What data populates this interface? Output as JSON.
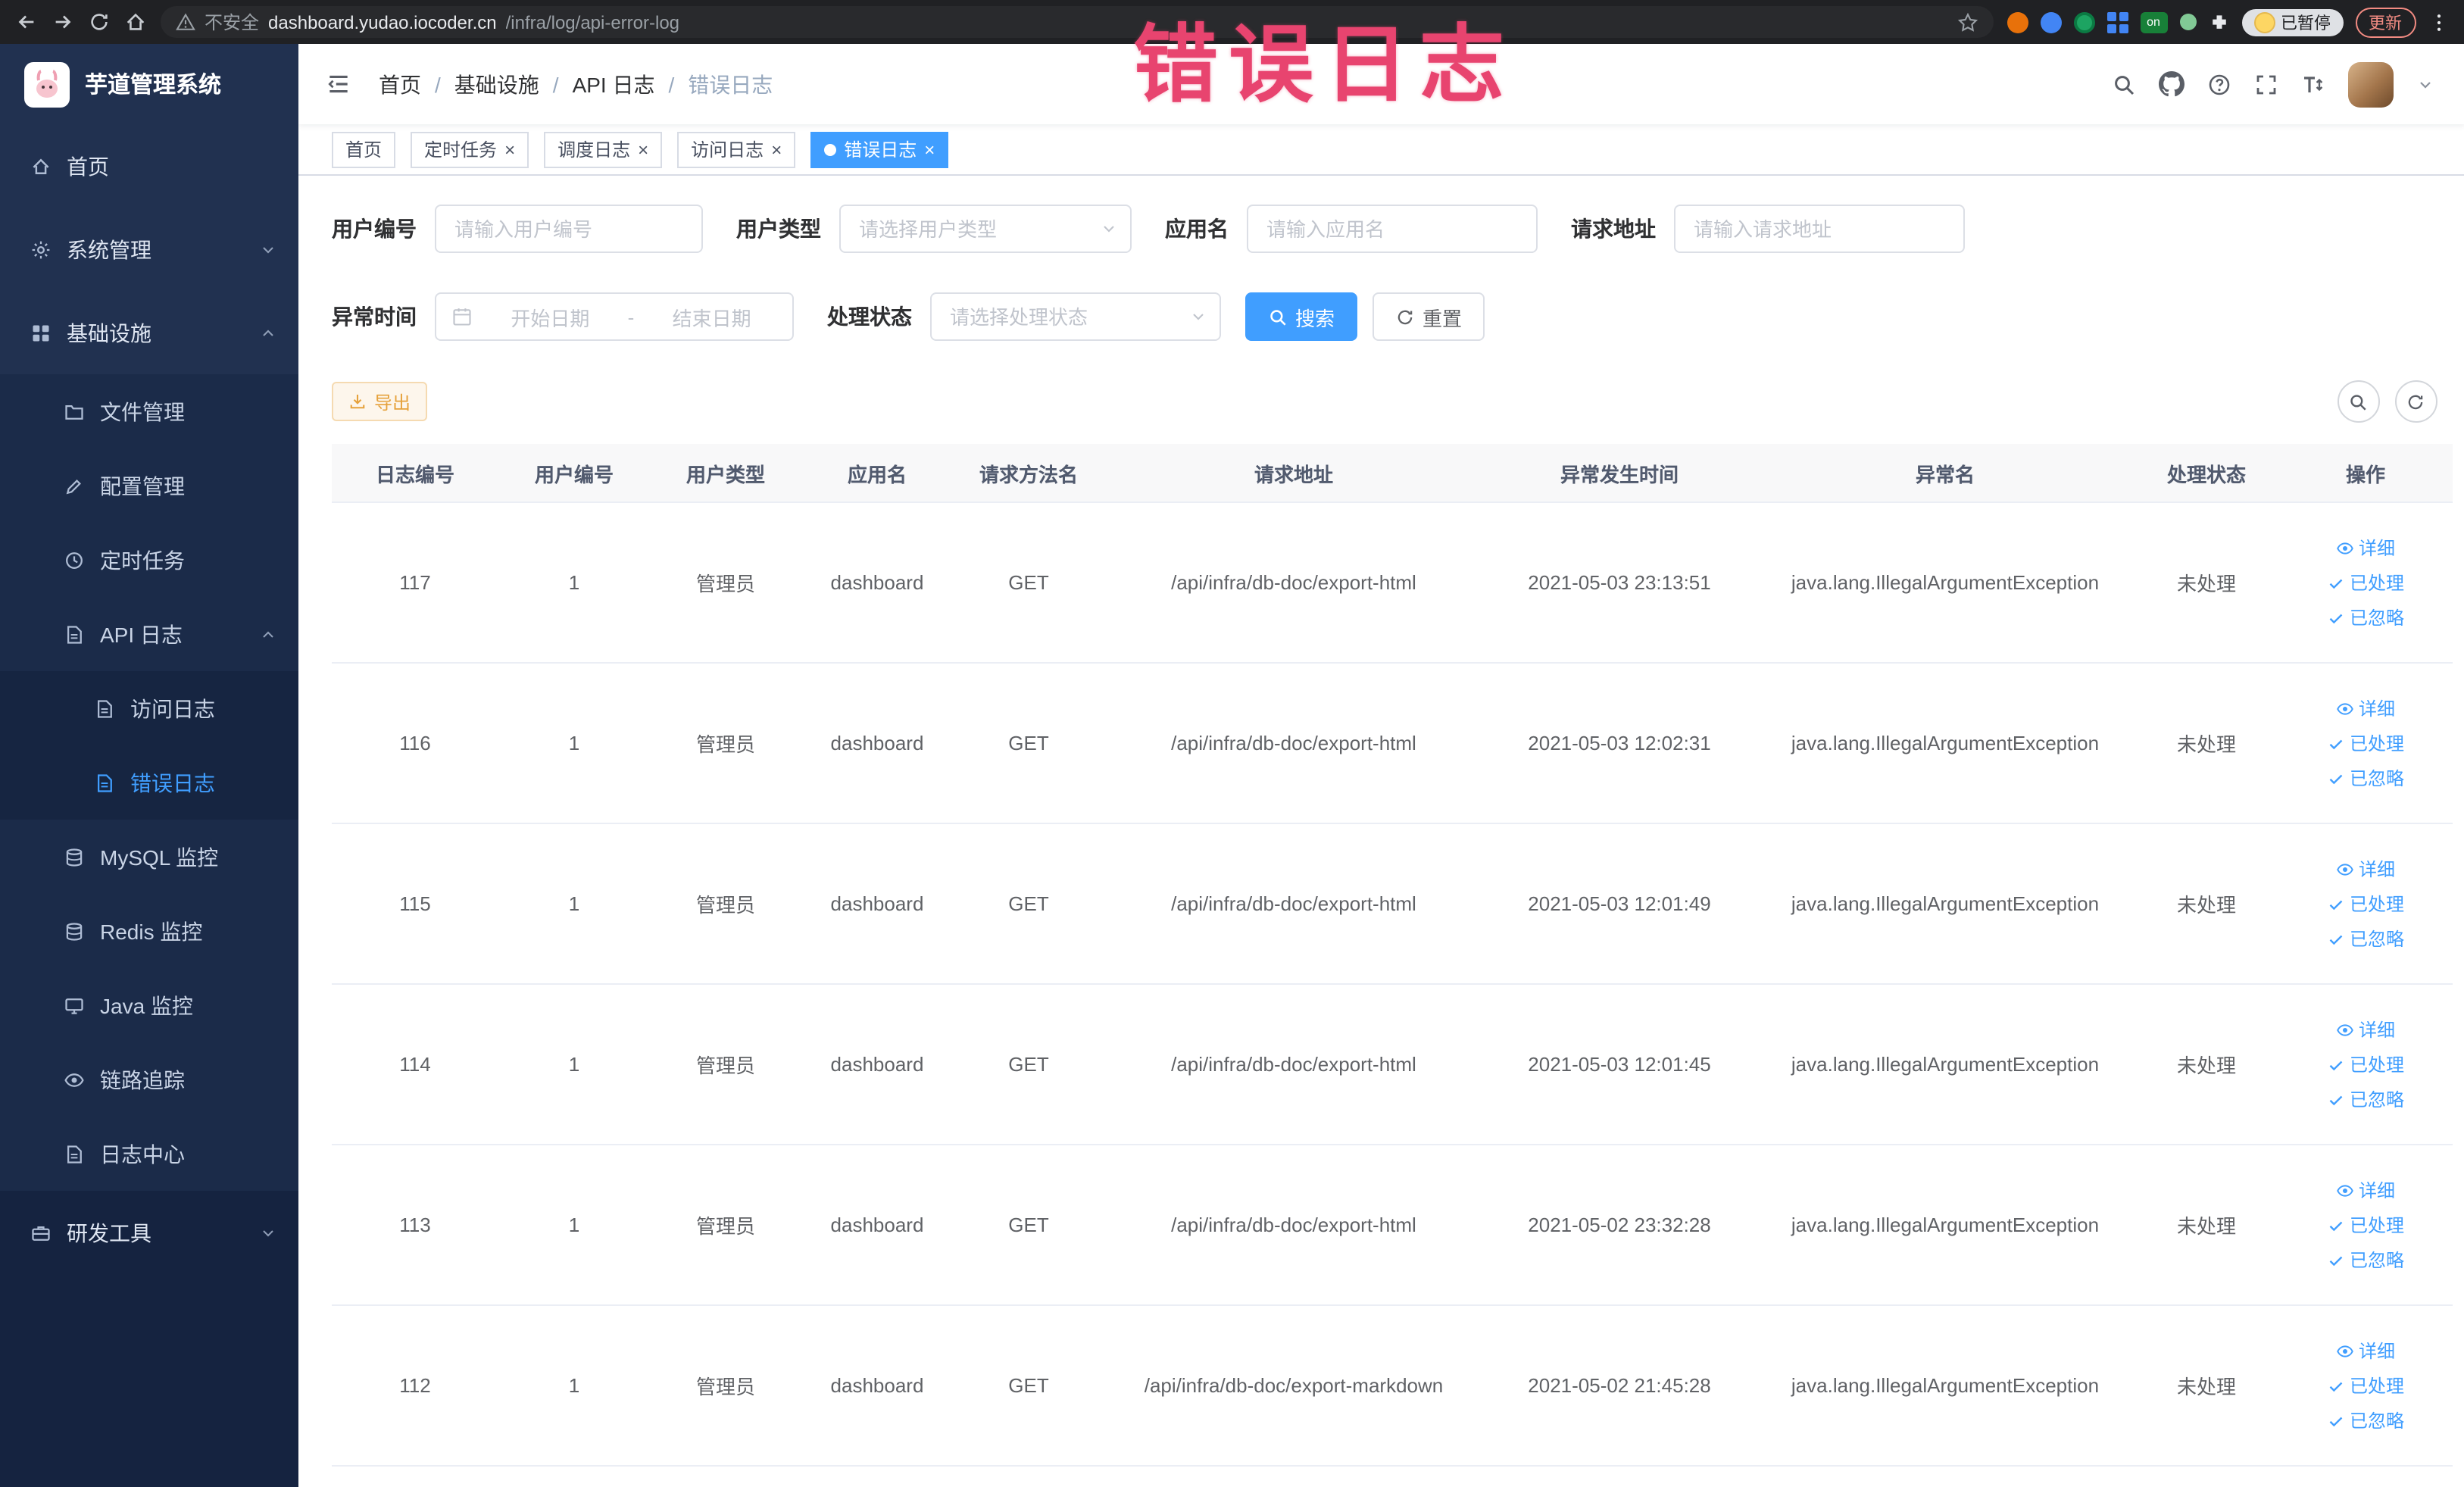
{
  "annotation": {
    "text": "错误日志",
    "color": "#e8446f"
  },
  "browser": {
    "security_label": "不安全",
    "url_host": "dashboard.yudao.iocoder.cn",
    "url_path": "/infra/log/api-error-log",
    "paused_chip": "已暂停",
    "update_chip": "更新",
    "extension_badge_on": "on"
  },
  "ui": {
    "close": "×",
    "crumb_sep": "/"
  },
  "sidebar": {
    "logo_title": "芋道管理系统",
    "items": [
      {
        "name": "home",
        "label": "首页",
        "icon": "home",
        "level": 1
      },
      {
        "name": "system-mgmt",
        "label": "系统管理",
        "icon": "gear",
        "level": 1,
        "arrow": "down"
      },
      {
        "name": "infrastructure",
        "label": "基础设施",
        "icon": "grid",
        "level": 1,
        "arrow": "up"
      },
      {
        "name": "file-mgmt",
        "label": "文件管理",
        "icon": "folder",
        "level": 2
      },
      {
        "name": "config-mgmt",
        "label": "配置管理",
        "icon": "edit",
        "level": 2
      },
      {
        "name": "scheduled-tasks",
        "label": "定时任务",
        "icon": "clock",
        "level": 2
      },
      {
        "name": "api-log",
        "label": "API 日志",
        "icon": "doc",
        "level": 2,
        "arrow": "up"
      },
      {
        "name": "access-log",
        "label": "访问日志",
        "icon": "doc",
        "level": 3
      },
      {
        "name": "error-log",
        "label": "错误日志",
        "icon": "doc",
        "level": 3,
        "active": true
      },
      {
        "name": "mysql-monitor",
        "label": "MySQL 监控",
        "icon": "db",
        "level": 2
      },
      {
        "name": "redis-monitor",
        "label": "Redis 监控",
        "icon": "db",
        "level": 2
      },
      {
        "name": "java-monitor",
        "label": "Java 监控",
        "icon": "monitor",
        "level": 2
      },
      {
        "name": "tracing",
        "label": "链路追踪",
        "icon": "eye",
        "level": 2
      },
      {
        "name": "log-center",
        "label": "日志中心",
        "icon": "doc",
        "level": 2
      },
      {
        "name": "dev-tools",
        "label": "研发工具",
        "icon": "tools",
        "level": 1,
        "arrow": "down",
        "dark": true
      }
    ]
  },
  "header": {
    "breadcrumbs": [
      "首页",
      "基础设施",
      "API 日志",
      "错误日志"
    ]
  },
  "tabs": [
    {
      "name": "home",
      "label": "首页",
      "closable": false,
      "active": false
    },
    {
      "name": "scheduled-tasks",
      "label": "定时任务",
      "closable": true,
      "active": false
    },
    {
      "name": "schedule-log",
      "label": "调度日志",
      "closable": true,
      "active": false
    },
    {
      "name": "access-log",
      "label": "访问日志",
      "closable": true,
      "active": false
    },
    {
      "name": "error-log",
      "label": "错误日志",
      "closable": true,
      "active": true
    }
  ],
  "filters": {
    "user_id": {
      "label": "用户编号",
      "placeholder": "请输入用户编号"
    },
    "user_type": {
      "label": "用户类型",
      "placeholder": "请选择用户类型"
    },
    "app_name": {
      "label": "应用名",
      "placeholder": "请输入应用名"
    },
    "request_url": {
      "label": "请求地址",
      "placeholder": "请输入请求地址"
    },
    "exception_time": {
      "label": "异常时间",
      "start": "开始日期",
      "separator": "-",
      "end": "结束日期"
    },
    "process_status": {
      "label": "处理状态",
      "placeholder": "请选择处理状态"
    },
    "search_label": "搜索",
    "reset_label": "重置"
  },
  "toolbar": {
    "export_label": "导出"
  },
  "table": {
    "columns": [
      "日志编号",
      "用户编号",
      "用户类型",
      "应用名",
      "请求方法名",
      "请求地址",
      "异常发生时间",
      "异常名",
      "处理状态",
      "操作"
    ],
    "actions": {
      "detail": "详细",
      "processed": "已处理",
      "ignored": "已忽略"
    },
    "rows": [
      {
        "id": "117",
        "user_id": "1",
        "user_type": "管理员",
        "app": "dashboard",
        "method": "GET",
        "url": "/api/infra/db-doc/export-html",
        "time": "2021-05-03 23:13:51",
        "exception": "java.lang.IllegalArgumentException",
        "status": "未处理"
      },
      {
        "id": "116",
        "user_id": "1",
        "user_type": "管理员",
        "app": "dashboard",
        "method": "GET",
        "url": "/api/infra/db-doc/export-html",
        "time": "2021-05-03 12:02:31",
        "exception": "java.lang.IllegalArgumentException",
        "status": "未处理"
      },
      {
        "id": "115",
        "user_id": "1",
        "user_type": "管理员",
        "app": "dashboard",
        "method": "GET",
        "url": "/api/infra/db-doc/export-html",
        "time": "2021-05-03 12:01:49",
        "exception": "java.lang.IllegalArgumentException",
        "status": "未处理"
      },
      {
        "id": "114",
        "user_id": "1",
        "user_type": "管理员",
        "app": "dashboard",
        "method": "GET",
        "url": "/api/infra/db-doc/export-html",
        "time": "2021-05-03 12:01:45",
        "exception": "java.lang.IllegalArgumentException",
        "status": "未处理"
      },
      {
        "id": "113",
        "user_id": "1",
        "user_type": "管理员",
        "app": "dashboard",
        "method": "GET",
        "url": "/api/infra/db-doc/export-html",
        "time": "2021-05-02 23:32:28",
        "exception": "java.lang.IllegalArgumentException",
        "status": "未处理"
      },
      {
        "id": "112",
        "user_id": "1",
        "user_type": "管理员",
        "app": "dashboard",
        "method": "GET",
        "url": "/api/infra/db-doc/export-markdown",
        "time": "2021-05-02 21:45:28",
        "exception": "java.lang.IllegalArgumentException",
        "status": "未处理"
      }
    ]
  },
  "colors": {
    "primary": "#409eff",
    "warning": "#e6a23c",
    "sidebar_bg": "#213150",
    "chrome_bg": "#202124"
  }
}
